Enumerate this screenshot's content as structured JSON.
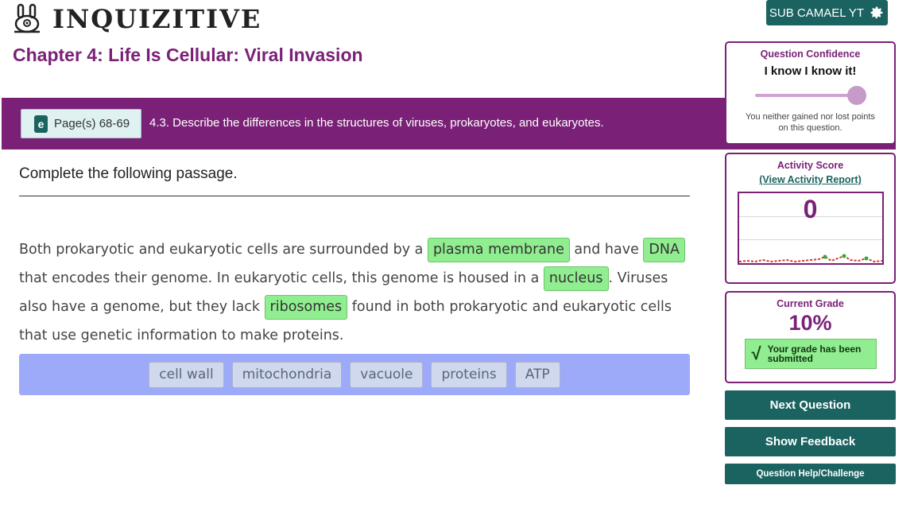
{
  "header": {
    "logo_text": "INQUIZITIVE",
    "user_button_label": "SUB CAMAEL YT"
  },
  "chapter_title": "Chapter 4: Life Is Cellular: Viral Invasion",
  "objective": {
    "pages_label": "Page(s) 68-69",
    "text": "4.3. Describe the differences in the structures of viruses, prokaryotes, and eukaryotes."
  },
  "question": {
    "prompt": "Complete the following passage.",
    "passage": {
      "t1": "Both prokaryotic and eukaryotic cells are surrounded by a ",
      "b1": "plasma membrane",
      "t2": " and have ",
      "b2": "DNA",
      "t3": " that encodes their genome. In eukaryotic cells, this genome is housed in a ",
      "b3": "nucleus",
      "t4": ". Viruses also have a genome, but they lack ",
      "b4": "ribosomes",
      "t5": " found in both prokaryotic and eukaryotic cells that use genetic information to make proteins."
    },
    "word_bank": [
      "cell wall",
      "mitochondria",
      "vacuole",
      "proteins",
      "ATP"
    ]
  },
  "confidence": {
    "heading": "Question Confidence",
    "value": "I know I know it!",
    "level": 1.0,
    "note": "You neither gained nor lost points on this question."
  },
  "activity_score": {
    "heading": "Activity Score",
    "link": "(View Activity Report)",
    "value": "0"
  },
  "grade": {
    "heading": "Current Grade",
    "value": "10%",
    "status": "Your grade has been submitted"
  },
  "buttons": {
    "next": "Next Question",
    "feedback": "Show Feedback",
    "help": "Question Help/Challenge"
  },
  "colors": {
    "brand_purple": "#7a2177",
    "brand_teal": "#1b6361",
    "correct_green": "#90ee90",
    "word_bank_bg": "#9daaf9"
  }
}
